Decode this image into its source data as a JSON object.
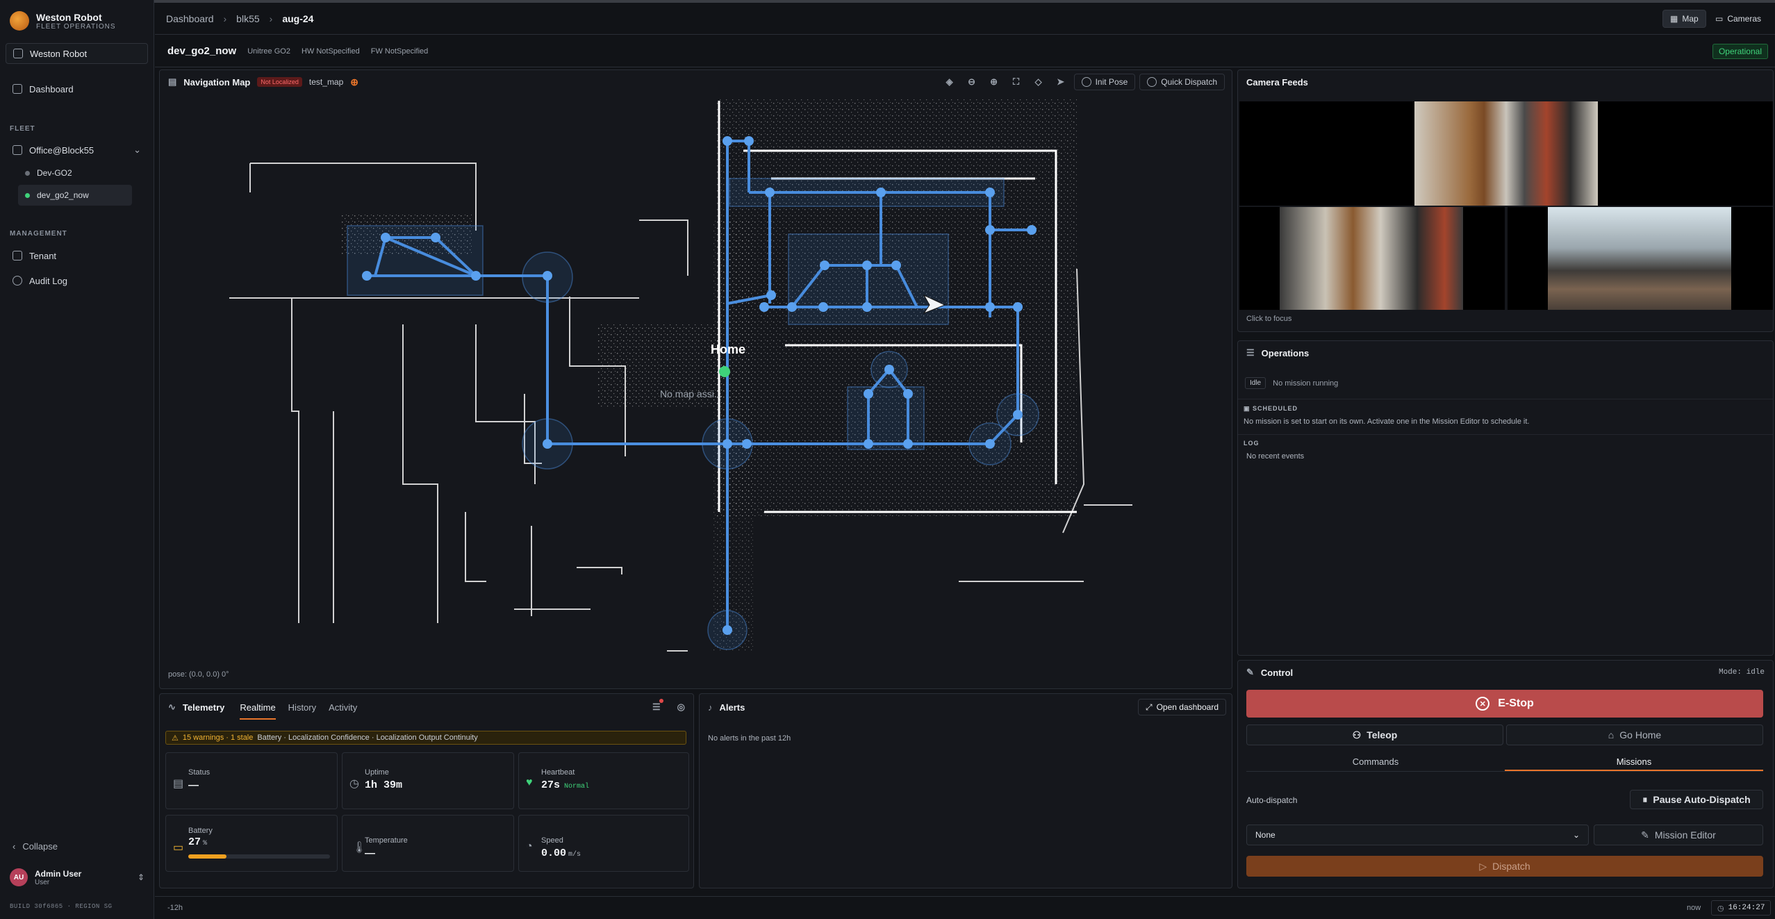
{
  "brand": {
    "name": "Weston Robot",
    "subtitle": "FLEET OPERATIONS"
  },
  "sidebar": {
    "tenant": "Weston Robot",
    "dashboard": "Dashboard",
    "fleet_heading": "FLEET",
    "group": "Office@Block55",
    "robots": [
      {
        "name": "Dev-GO2",
        "status_color": "#6b7078"
      },
      {
        "name": "dev_go2_now",
        "status_color": "#3fd27a"
      }
    ],
    "management_heading": "MANAGEMENT",
    "tenant_link": "Tenant",
    "audit_log": "Audit Log",
    "collapse": "Collapse",
    "user": {
      "initials": "AU",
      "name": "Admin User",
      "role": "User"
    },
    "build": "BUILD 30f6865 · REGION SG"
  },
  "header": {
    "breadcrumb": [
      "Dashboard",
      "blk55",
      "aug-24"
    ],
    "tab_map": "Map",
    "tab_cameras": "Cameras"
  },
  "robot": {
    "name": "dev_go2_now",
    "model": "Unitree GO2",
    "hw": "HW NotSpecified",
    "fw": "FW NotSpecified",
    "status": "Operational"
  },
  "map": {
    "title": "Navigation Map",
    "localization": "Not Localized",
    "map_name": "test_map",
    "init_pose": "Init Pose",
    "quick_dispatch": "Quick Dispatch",
    "home_label": "Home",
    "no_map": "No map assi...",
    "pose": "pose: (0.0, 0.0) 0°"
  },
  "cameras": {
    "title": "Camera Feeds",
    "hint": "Click to focus"
  },
  "operations": {
    "title": "Operations",
    "state": "Idle",
    "mission": "No mission running",
    "scheduled_heading": "SCHEDULED",
    "scheduled_text": "No mission is set to start on its own. Activate one in the Mission Editor to schedule it.",
    "log_heading": "LOG",
    "log_text": "No recent events"
  },
  "telemetry": {
    "title": "Telemetry",
    "tabs": [
      "Realtime",
      "History",
      "Activity"
    ],
    "warn_count": "15 warnings · 1 stale",
    "warn_items": "Battery · Localization Confidence · Localization Output Continuity",
    "status_label": "Status",
    "status_value": "—",
    "uptime_label": "Uptime",
    "uptime_value": "1h 39m",
    "heartbeat_label": "Heartbeat",
    "heartbeat_value": "27s",
    "heartbeat_state": "Normal",
    "battery_label": "Battery",
    "battery_value": "27",
    "battery_unit": "%",
    "battery_level": 0.27,
    "temperature_label": "Temperature",
    "temperature_value": "—",
    "speed_label": "Speed",
    "speed_value": "0.00",
    "speed_unit": "m/s"
  },
  "alerts": {
    "title": "Alerts",
    "open_dashboard": "Open dashboard",
    "empty": "No alerts in the past 12h"
  },
  "control": {
    "title": "Control",
    "mode": "Mode: idle",
    "estop": "E-Stop",
    "teleop": "Teleop",
    "go_home": "Go Home",
    "tabs": [
      "Commands",
      "Missions"
    ],
    "auto_dispatch": "Auto-dispatch",
    "pause": "Pause Auto-Dispatch",
    "select_value": "None",
    "mission_editor": "Mission Editor",
    "dispatch": "Dispatch"
  },
  "timeline": {
    "start": "-12h",
    "now": "now",
    "time": "16:24:27"
  }
}
